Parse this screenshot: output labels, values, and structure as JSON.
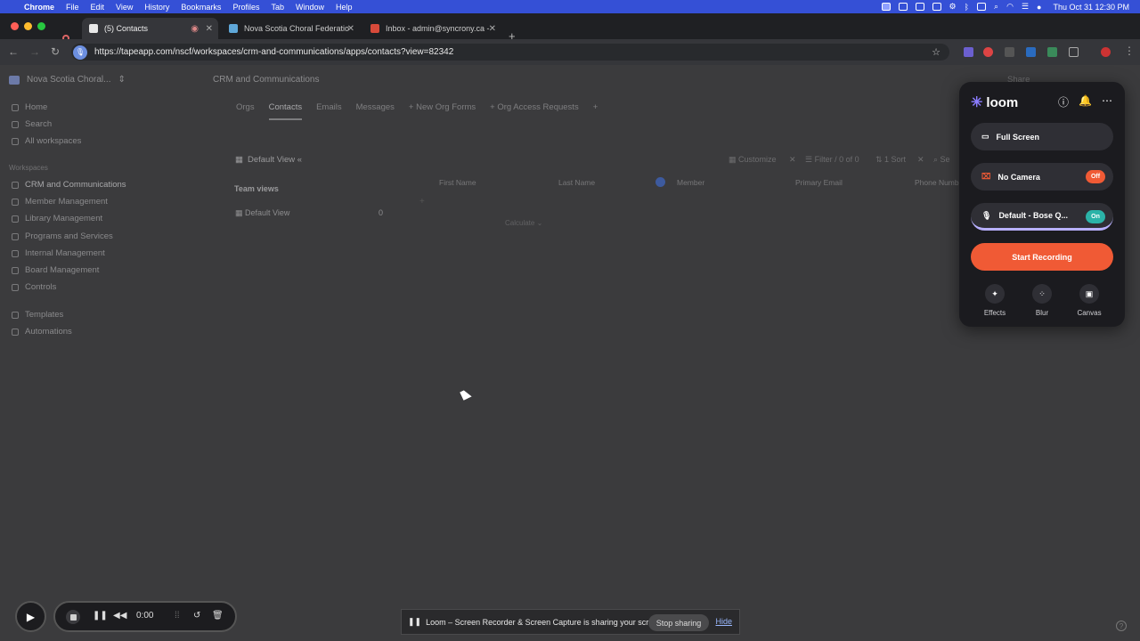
{
  "menubar": {
    "app": "Chrome",
    "items": [
      "File",
      "Edit",
      "View",
      "History",
      "Bookmarks",
      "Profiles",
      "Tab",
      "Window",
      "Help"
    ],
    "clock": "Thu Oct 31  12:30 PM"
  },
  "tabs": [
    {
      "label": "(5) Contacts",
      "favicon_color": "#e8e8e8"
    },
    {
      "label": "Nova Scotia Choral Federatio",
      "favicon_color": "#5fa7d8"
    },
    {
      "label": "Inbox - admin@syncrony.ca -",
      "favicon_color": "#d84a3a"
    }
  ],
  "address": {
    "url": "https://tapeapp.com/nscf/workspaces/crm-and-communications/apps/contacts?view=82342"
  },
  "sidebar": {
    "workspace": "Nova Scotia Choral...",
    "nav": [
      "Home",
      "Search",
      "All workspaces"
    ],
    "section_label": "Workspaces",
    "workspaces": [
      "CRM and Communications",
      "Member Management",
      "Library Management",
      "Programs and Services",
      "Internal Management",
      "Board Management",
      "Controls"
    ],
    "extras": [
      "Templates",
      "Automations"
    ]
  },
  "breadcrumb": "CRM and Communications",
  "app_tabs": [
    "Orgs",
    "Contacts",
    "Emails",
    "Messages",
    "+ New Org Forms",
    "+ Org Access Requests"
  ],
  "view": {
    "name": "Default View «",
    "team_views_label": "Team views",
    "default_view_label": "Default View",
    "default_view_count": "0",
    "columns": [
      "First Name",
      "Last Name",
      "Member",
      "Primary Email",
      "Phone Numb"
    ],
    "customize": "Customize",
    "filter": "Filter / 0 of 0",
    "sort": "1 Sort",
    "calculate": "Calculate ⌄",
    "share": "Share"
  },
  "loom": {
    "brand": "loom",
    "options": [
      {
        "label": "Full Screen",
        "icon": "monitor-icon"
      },
      {
        "label": "No Camera",
        "icon": "camera-off-icon",
        "toggle": "Off",
        "toggle_color": "#f05a35"
      },
      {
        "label": "Default - Bose Q...",
        "icon": "mic-icon",
        "toggle": "On",
        "toggle_color": "#2bb3a8"
      }
    ],
    "record_button": "Start Recording",
    "effects": [
      "Effects",
      "Blur",
      "Canvas"
    ]
  },
  "recorder": {
    "time": "0:00"
  },
  "share_banner": {
    "message": "Loom – Screen Recorder & Screen Capture is sharing your screen.",
    "stop": "Stop sharing",
    "hide": "Hide"
  }
}
